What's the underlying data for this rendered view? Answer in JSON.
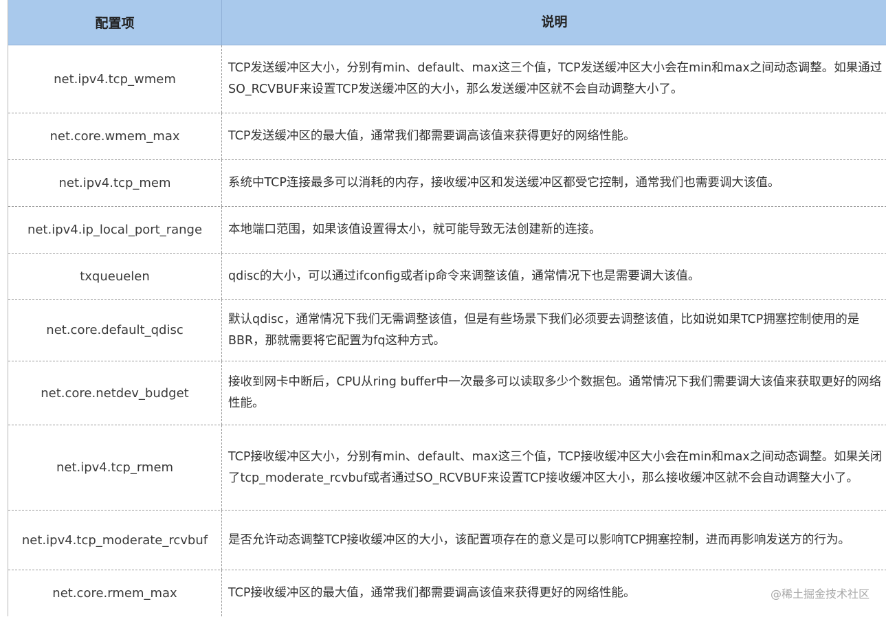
{
  "table": {
    "headers": {
      "key": "配置项",
      "desc": "说明"
    },
    "rows": [
      {
        "key": "net.ipv4.tcp_wmem",
        "desc": "TCP发送缓冲区大小，分别有min、default、max这三个值，TCP发送缓冲区大小会在min和max之间动态调整。如果通过SO_RCVBUF来设置TCP发送缓冲区的大小，那么发送缓冲区就不会自动调整大小了。"
      },
      {
        "key": "net.core.wmem_max",
        "desc": "TCP发送缓冲区的最大值，通常我们都需要调高该值来获得更好的网络性能。"
      },
      {
        "key": "net.ipv4.tcp_mem",
        "desc": "系统中TCP连接最多可以消耗的内存，接收缓冲区和发送缓冲区都受它控制，通常我们也需要调大该值。"
      },
      {
        "key": "net.ipv4.ip_local_port_range",
        "desc": "本地端口范围，如果该值设置得太小，就可能导致无法创建新的连接。"
      },
      {
        "key": "txqueuelen",
        "desc": "qdisc的大小，可以通过ifconfig或者ip命令来调整该值，通常情况下也是需要调大该值。"
      },
      {
        "key": "net.core.default_qdisc",
        "desc": "默认qdisc，通常情况下我们无需调整该值，但是有些场景下我们必须要去调整该值，比如说如果TCP拥塞控制使用的是BBR，那就需要将它配置为fq这种方式。"
      },
      {
        "key": "net.core.netdev_budget",
        "desc": "接收到网卡中断后，CPU从ring buffer中一次最多可以读取多少个数据包。通常情况下我们需要调大该值来获取更好的网络性能。"
      },
      {
        "key": "net.ipv4.tcp_rmem",
        "desc": "TCP接收缓冲区大小，分别有min、default、max这三个值，TCP接收缓冲区大小会在min和max之间动态调整。如果关闭了tcp_moderate_rcvbuf或者通过SO_RCVBUF来设置TCP接收缓冲区大小，那么接收缓冲区就不会自动调整大小了。"
      },
      {
        "key": "net.ipv4.tcp_moderate_rcvbuf",
        "desc": "是否允许动态调整TCP接收缓冲区的大小，该配置项存在的意义是可以影响TCP拥塞控制，进而再影响发送方的行为。"
      },
      {
        "key": "net.core.rmem_max",
        "desc": "TCP接收缓冲区的最大值，通常我们都需要调高该值来获得更好的网络性能。"
      }
    ]
  },
  "watermark": "@稀土掘金技术社区"
}
